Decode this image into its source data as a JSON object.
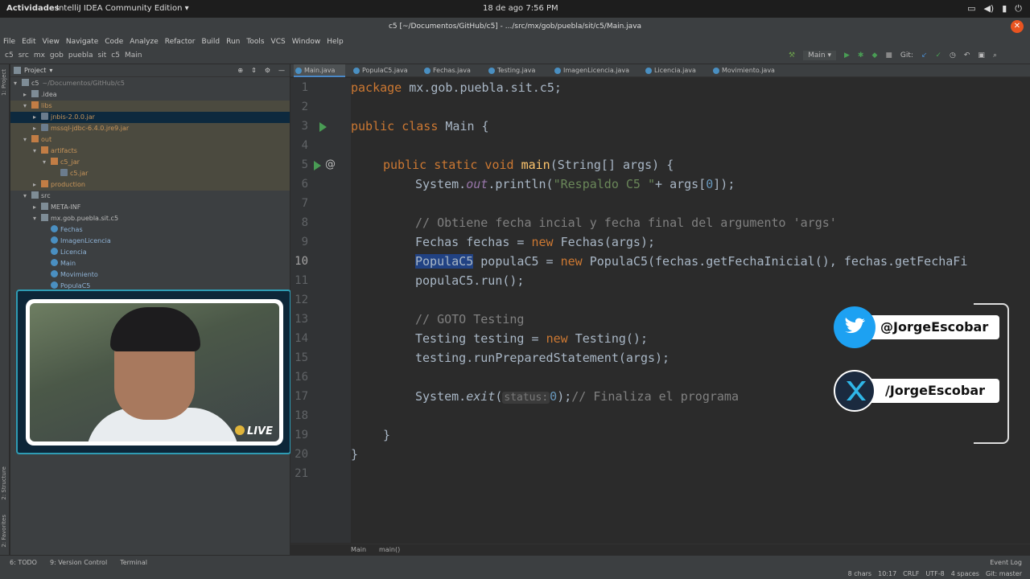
{
  "os_bar": {
    "activities": "Actividades",
    "app_name": "IntelliJ IDEA Community Edition",
    "clock": "18 de ago  7:56 PM"
  },
  "window": {
    "title": "c5 [~/Documentos/GitHub/c5] - .../src/mx/gob/puebla/sit/c5/Main.java"
  },
  "menu": [
    "File",
    "Edit",
    "View",
    "Navigate",
    "Code",
    "Analyze",
    "Refactor",
    "Build",
    "Run",
    "Tools",
    "VCS",
    "Window",
    "Help"
  ],
  "nav": {
    "crumbs": [
      "c5",
      "src",
      "mx",
      "gob",
      "puebla",
      "sit",
      "c5",
      "Main"
    ],
    "run_config": "Main",
    "git_label": "Git:"
  },
  "side_labels": {
    "project": "1: Project",
    "structure": "2: Structure",
    "favorites": "2: Favorites"
  },
  "project": {
    "title": "Project",
    "tree": [
      {
        "label": "c5",
        "suffix": "~/Documentos/GitHub/c5",
        "depth": 0,
        "open": true,
        "kind": "folder"
      },
      {
        "label": ".idea",
        "depth": 1,
        "open": false,
        "kind": "folder"
      },
      {
        "label": "libs",
        "depth": 1,
        "open": true,
        "kind": "folder-o"
      },
      {
        "label": "jnbis-2.0.0.jar",
        "depth": 2,
        "open": false,
        "kind": "jar",
        "selected": true
      },
      {
        "label": "mssql-jdbc-6.4.0.jre9.jar",
        "depth": 2,
        "open": false,
        "kind": "jar"
      },
      {
        "label": "out",
        "depth": 1,
        "open": true,
        "kind": "folder-o"
      },
      {
        "label": "artifacts",
        "depth": 2,
        "open": true,
        "kind": "folder-o"
      },
      {
        "label": "c5_jar",
        "depth": 3,
        "open": true,
        "kind": "folder-o"
      },
      {
        "label": "c5.jar",
        "depth": 4,
        "kind": "jar"
      },
      {
        "label": "production",
        "depth": 2,
        "open": false,
        "kind": "folder-o"
      },
      {
        "label": "src",
        "depth": 1,
        "open": true,
        "kind": "folder"
      },
      {
        "label": "META-INF",
        "depth": 2,
        "open": false,
        "kind": "folder"
      },
      {
        "label": "mx.gob.puebla.sit.c5",
        "depth": 2,
        "open": true,
        "kind": "folder"
      },
      {
        "label": "Fechas",
        "depth": 3,
        "kind": "class"
      },
      {
        "label": "ImagenLicencia",
        "depth": 3,
        "kind": "class"
      },
      {
        "label": "Licencia",
        "depth": 3,
        "kind": "class"
      },
      {
        "label": "Main",
        "depth": 3,
        "kind": "class"
      },
      {
        "label": "Movimiento",
        "depth": 3,
        "kind": "class"
      },
      {
        "label": "PopulaC5",
        "depth": 3,
        "kind": "class"
      }
    ]
  },
  "webcam": {
    "live": "LIVE"
  },
  "tabs": [
    "Main.java",
    "PopulaC5.java",
    "Fechas.java",
    "Testing.java",
    "ImagenLicencia.java",
    "Licencia.java",
    "Movimiento.java"
  ],
  "code": {
    "line_numbers": [
      "1",
      "2",
      "3",
      "4",
      "5",
      "6",
      "7",
      "8",
      "9",
      "10",
      "11",
      "12",
      "13",
      "14",
      "15",
      "16",
      "17",
      "18",
      "19",
      "20",
      "21"
    ],
    "l1_kw": "package ",
    "l1_rest": "mx.gob.puebla.sit.c5;",
    "l3_kw": "public class ",
    "l3_rest": "Main {",
    "l5_kw": "public static void ",
    "l5_fn": "main",
    "l5_rest": "(String[] args) {",
    "l6_a": "System.",
    "l6_out": "out",
    "l6_b": ".println(",
    "l6_str": "\"Respaldo C5 \"",
    "l6_c": "+ args[",
    "l6_num": "0",
    "l6_d": "]);",
    "l8_cm": "// Obtiene fecha incial y fecha final del argumento 'args'",
    "l9_a": "Fechas fechas = ",
    "l9_kw": "new ",
    "l9_b": "Fechas(args);",
    "l10_sel": "PopulaC5",
    "l10_a": " populaC5 = ",
    "l10_kw": "new ",
    "l10_b": "PopulaC5(fechas.getFechaInicial(), fechas.getFechaFi",
    "l11": "populaC5.run();",
    "l13_cm": "// GOTO Testing",
    "l14_a": "Testing testing = ",
    "l14_kw": "new ",
    "l14_b": "Testing();",
    "l15": "testing.runPreparedStatement(args);",
    "l17_a": "System.",
    "l17_exit": "exit",
    "l17_b": "(",
    "l17_hint": "status:",
    "l17_num": "0",
    "l17_c": ");",
    "l17_cm": "// Finaliza el programa",
    "l19": "}",
    "l20": "}"
  },
  "social": {
    "twitter": "@JorgeEscobar",
    "other": "/JorgeEscobar"
  },
  "editor_breadcrumb": [
    "Main",
    "main()"
  ],
  "bottom": {
    "todo": "6: TODO",
    "vcs": "9: Version Control",
    "terminal": "Terminal",
    "event_log": "Event Log",
    "chars": "8 chars",
    "pos": "10:17",
    "eol": "CRLF",
    "enc": "UTF-8",
    "indent": "4 spaces",
    "git": "Git: master"
  }
}
